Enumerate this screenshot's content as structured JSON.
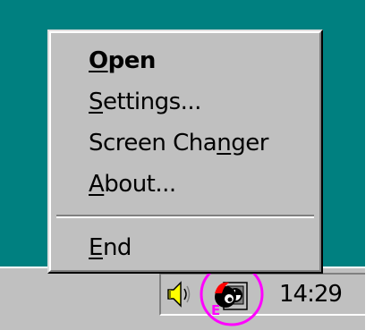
{
  "context_menu": {
    "items": [
      {
        "before": "",
        "hotkey": "O",
        "after": "pen",
        "default": true
      },
      {
        "before": "",
        "hotkey": "S",
        "after": "ettings...",
        "default": false
      },
      {
        "before": "Screen Cha",
        "hotkey": "n",
        "after": "ger",
        "default": false
      },
      {
        "before": "",
        "hotkey": "A",
        "after": "bout...",
        "default": false
      },
      {
        "before": "",
        "hotkey": "E",
        "after": "nd",
        "default": false
      }
    ]
  },
  "tray": {
    "clock": "14:29",
    "icons": [
      "speaker-icon",
      "screen-changer-app-icon"
    ],
    "app_badge_letter": "E"
  },
  "colors": {
    "desktop": "#008080",
    "face": "#c0c0c0",
    "highlight_circle": "#ff00ff"
  }
}
